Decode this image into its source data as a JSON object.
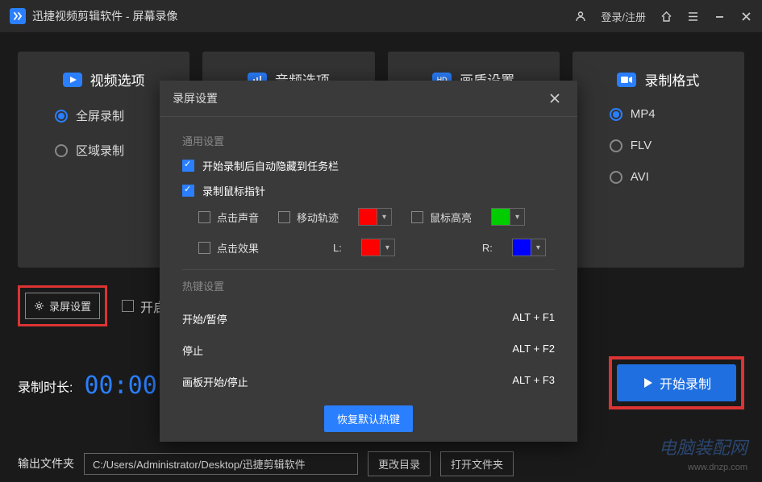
{
  "titlebar": {
    "app_name": "迅捷视频剪辑软件 - 屏幕录像",
    "login_label": "登录/注册"
  },
  "cards": {
    "video": {
      "title": "视频选项",
      "options": [
        "全屏录制",
        "区域录制"
      ],
      "selected": 0
    },
    "audio": {
      "title": "音频选项"
    },
    "quality": {
      "title": "画质设置"
    },
    "format": {
      "title": "录制格式",
      "options": [
        "MP4",
        "FLV",
        "AVI"
      ],
      "selected": 0
    }
  },
  "below": {
    "settings_btn": "录屏设置",
    "enable_prefix": "开启"
  },
  "timer": {
    "label": "录制时长:",
    "value": "00:00"
  },
  "start": {
    "label": "开始录制"
  },
  "output": {
    "label": "输出文件夹",
    "path": "C:/Users/Administrator/Desktop/迅捷剪辑软件",
    "change": "更改目录",
    "open": "打开文件夹"
  },
  "dialog": {
    "title": "录屏设置",
    "general_section": "通用设置",
    "cb_hide_taskbar": "开始录制后自动隐藏到任务栏",
    "cb_record_cursor": "录制鼠标指针",
    "cb_click_sound": "点击声音",
    "cb_move_trail": "移动轨迹",
    "cb_mouse_highlight": "鼠标高亮",
    "cb_click_effect": "点击效果",
    "lbl_L": "L:",
    "lbl_R": "R:",
    "hotkey_section": "热键设置",
    "hotkeys": [
      {
        "name": "开始/暂停",
        "keys": "ALT + F1"
      },
      {
        "name": "停止",
        "keys": "ALT + F2"
      },
      {
        "name": "画板开始/停止",
        "keys": "ALT + F3"
      }
    ],
    "restore": "恢复默认热键"
  },
  "watermark": {
    "brand": "电脑装配网",
    "url": "www.dnzp.com"
  }
}
